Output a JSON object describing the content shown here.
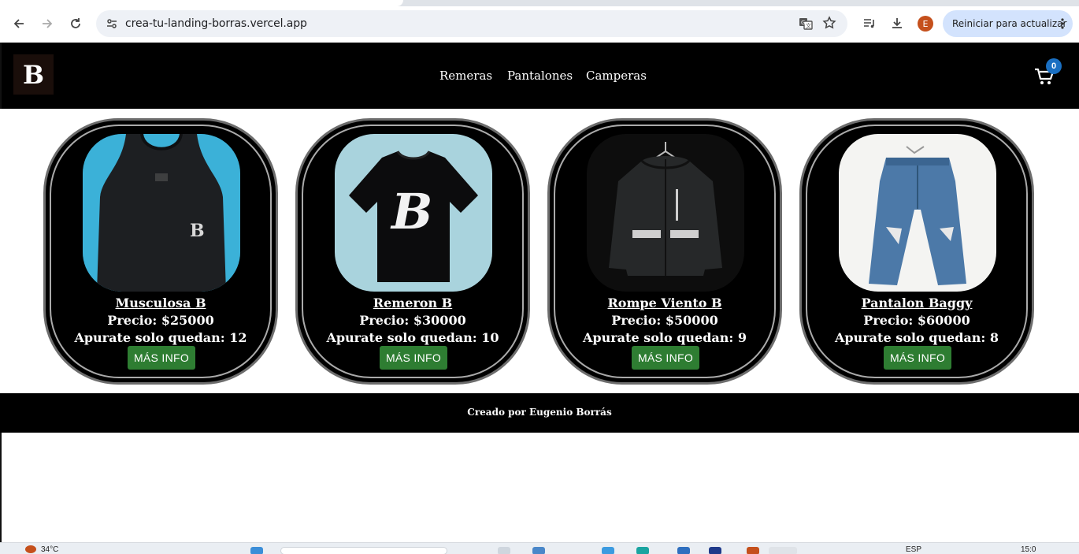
{
  "browser": {
    "url": "crea-tu-landing-borras.vercel.app",
    "avatar_letter": "E",
    "update_label": "Reiniciar para actualizar",
    "icons": [
      "back-icon",
      "forward-icon",
      "reload-icon",
      "site-info-icon",
      "translate-icon",
      "bookmark-star-icon",
      "media-icon",
      "download-icon",
      "menu-dots-icon"
    ]
  },
  "header": {
    "logo_letter": "B",
    "nav": [
      "Remeras",
      "Pantalones",
      "Camperas"
    ],
    "cart_count": "0",
    "cart_icon": "cart-icon"
  },
  "products": [
    {
      "name": "Musculosa B",
      "price": "Precio: $25000",
      "stock": "Apurate solo quedan: 12",
      "button": "MÁS INFO",
      "image": "tank-top"
    },
    {
      "name": "Remeron B",
      "price": "Precio: $30000",
      "stock": "Apurate solo quedan: 10",
      "button": "MÁS INFO",
      "image": "t-shirt"
    },
    {
      "name": "Rompe Viento B",
      "price": "Precio: $50000",
      "stock": "Apurate solo quedan: 9",
      "button": "MÁS INFO",
      "image": "windbreaker"
    },
    {
      "name": "Pantalon Baggy",
      "price": "Precio: $60000",
      "stock": "Apurate solo quedan: 8",
      "button": "MÁS INFO",
      "image": "jeans"
    }
  ],
  "footer": {
    "credit": "Creado por Eugenio Borrás"
  },
  "taskbar": {
    "weather": "34°C",
    "lang": "ESP",
    "clock": "15:0"
  },
  "colors": {
    "header_bg": "#000000",
    "button_green": "#2e7d32",
    "cart_badge": "#1a6fc2",
    "omnibox_bg": "#eef1f6",
    "update_pill": "#d3e3fd"
  }
}
